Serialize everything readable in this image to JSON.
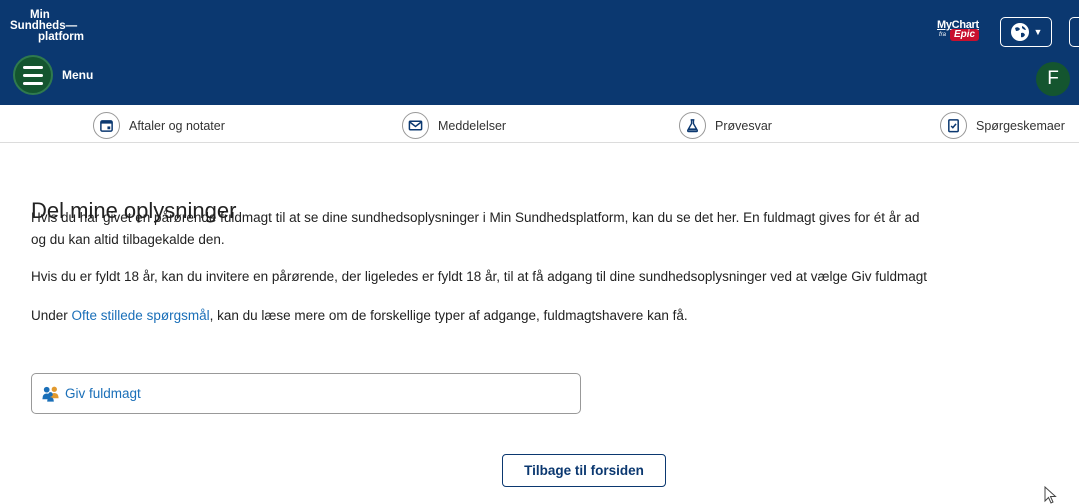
{
  "header": {
    "logo_lines": [
      "Min",
      "Sundheds—",
      "platform"
    ],
    "menu_label": "Menu",
    "mychart_text": "MyChart",
    "mychart_fra": "fra",
    "mychart_epic": "Epic",
    "avatar_initial": "F",
    "background_color": "#0b3870",
    "accent_green": "#14552f"
  },
  "nav": {
    "items": [
      {
        "label": "Aftaler og notater",
        "icon": "calendar-icon"
      },
      {
        "label": "Meddelelser",
        "icon": "envelope-icon"
      },
      {
        "label": "Prøvesvar",
        "icon": "flask-icon"
      },
      {
        "label": "Spørgeskemaer",
        "icon": "checklist-icon"
      }
    ]
  },
  "main": {
    "title": "Del mine oplysninger",
    "para1_line1": "Hvis du har givet en pårørende fuldmagt til at se dine sundhedsoplysninger i Min Sundhedsplatform, kan du se det her. En fuldmagt gives for ét år ad",
    "para1_line2": "og du kan altid tilbagekalde den.",
    "para2": "Hvis du er fyldt 18 år, kan du invitere en pårørende, der ligeledes er fyldt 18 år, til at få adgang til dine sundhedsoplysninger ved at vælge Giv fuldmagt",
    "para3_before": "Under ",
    "para3_link": "Ofte stillede spørgsmål",
    "para3_after": ", kan du læse mere om de forskellige typer af adgange, fuldmagtshavere kan få.",
    "giv_label": "Giv fuldmagt",
    "back_label": "Tilbage til forsiden",
    "link_color": "#1a6fb8"
  }
}
